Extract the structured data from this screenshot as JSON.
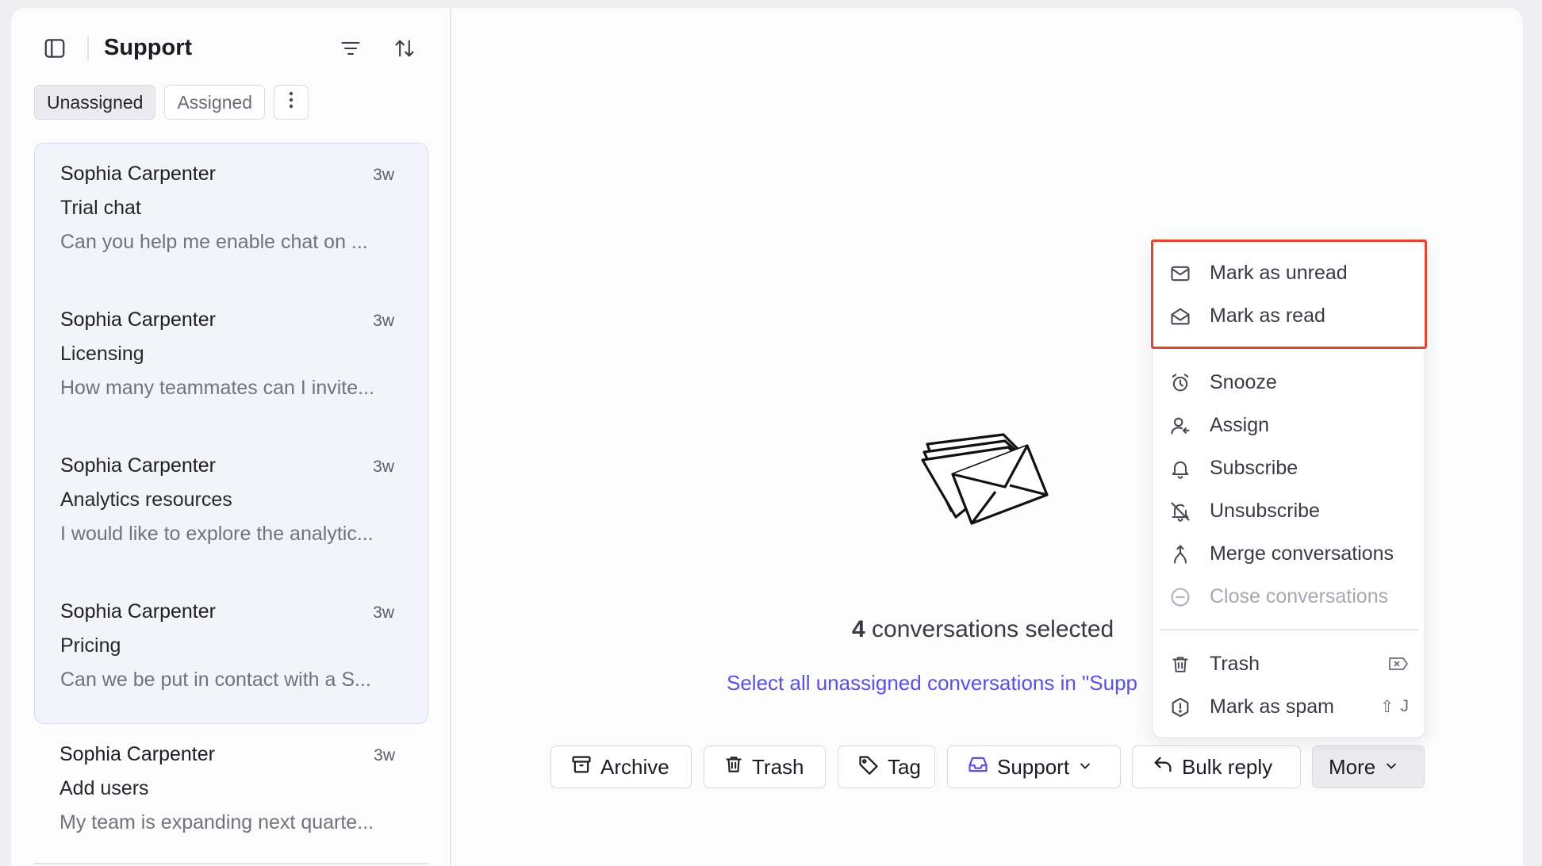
{
  "sidebar": {
    "title": "Support",
    "tabs": [
      {
        "label": "Unassigned",
        "active": true
      },
      {
        "label": "Assigned",
        "active": false
      }
    ],
    "conversations": [
      {
        "name": "Sophia Carpenter",
        "time": "3w",
        "subject": "Trial chat",
        "preview": "Can you help me enable chat on ...",
        "selected": true
      },
      {
        "name": "Sophia Carpenter",
        "time": "3w",
        "subject": "Licensing",
        "preview": "How many teammates can I invite...",
        "selected": true
      },
      {
        "name": "Sophia Carpenter",
        "time": "3w",
        "subject": "Analytics resources",
        "preview": "I would like to explore the analytic...",
        "selected": true
      },
      {
        "name": "Sophia Carpenter",
        "time": "3w",
        "subject": "Pricing",
        "preview": "Can we be put in contact with a S...",
        "selected": true
      },
      {
        "name": "Sophia Carpenter",
        "time": "3w",
        "subject": "Add users",
        "preview": "My team is expanding next quarte...",
        "selected": false
      }
    ]
  },
  "main": {
    "selected_count": "4",
    "selected_suffix": "conversations selected",
    "select_all_link": "Select all unassigned conversations in \"Supp",
    "actions": {
      "archive": "Archive",
      "trash": "Trash",
      "tag": "Tag",
      "inbox": "Support",
      "bulk_reply": "Bulk reply",
      "more": "More"
    }
  },
  "menu": {
    "items": [
      {
        "label": "Mark as unread",
        "icon": "envelope-icon"
      },
      {
        "label": "Mark as read",
        "icon": "envelope-open-icon"
      },
      {
        "label": "Snooze",
        "icon": "alarm-clock-icon"
      },
      {
        "label": "Assign",
        "icon": "user-assign-icon"
      },
      {
        "label": "Subscribe",
        "icon": "bell-icon"
      },
      {
        "label": "Unsubscribe",
        "icon": "bell-off-icon"
      },
      {
        "label": "Merge conversations",
        "icon": "merge-icon"
      },
      {
        "label": "Close conversations",
        "icon": "minus-circle-icon",
        "disabled": true
      },
      {
        "label": "Trash",
        "icon": "trash-icon",
        "shortcut": "⌦"
      },
      {
        "label": "Mark as spam",
        "icon": "spam-icon",
        "shortcut_mod": "⇧",
        "shortcut_key": "J"
      }
    ]
  },
  "colors": {
    "accent": "#5b50e0",
    "highlight": "#e0462f",
    "selected_bg": "#f3f4fb"
  }
}
